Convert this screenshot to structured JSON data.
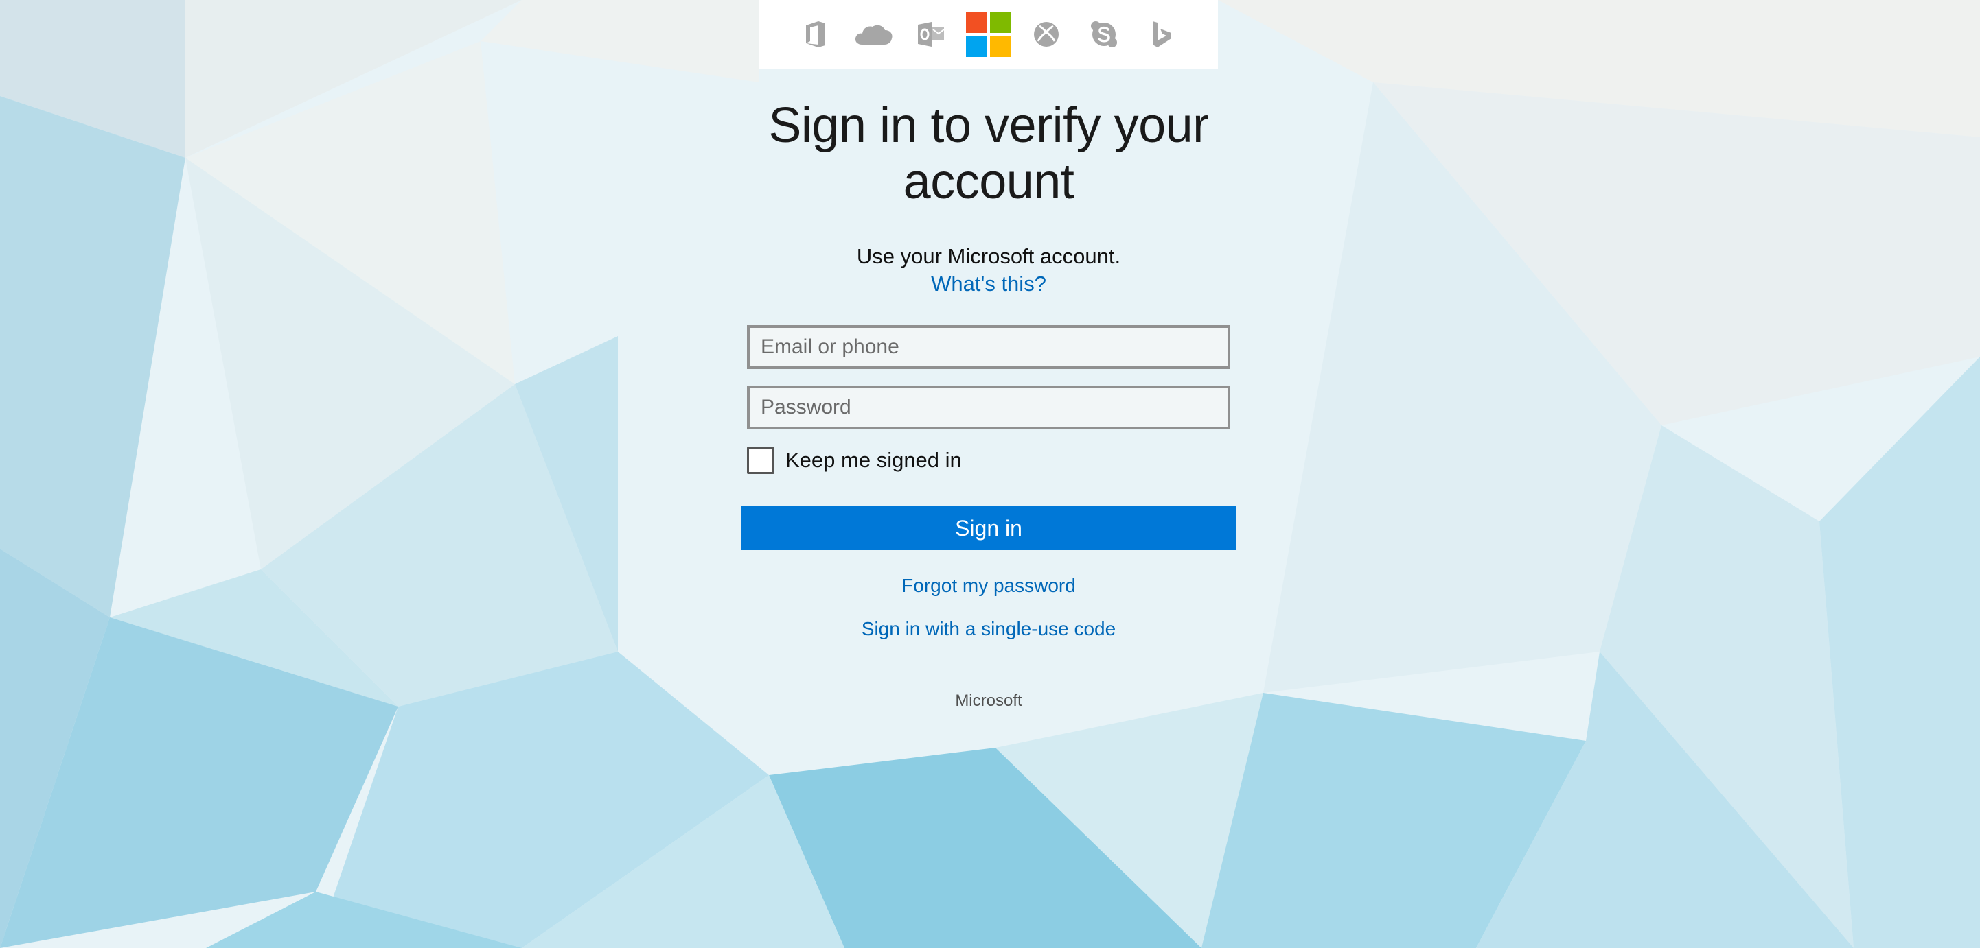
{
  "product_icons": [
    {
      "name": "office-icon"
    },
    {
      "name": "onedrive-icon"
    },
    {
      "name": "outlook-icon"
    },
    {
      "name": "microsoft-logo-icon",
      "colors": [
        "#f25022",
        "#7fba00",
        "#00a4ef",
        "#ffb900"
      ]
    },
    {
      "name": "xbox-icon"
    },
    {
      "name": "skype-icon"
    },
    {
      "name": "bing-icon"
    }
  ],
  "colors": {
    "accent": "#0078d7",
    "link": "#0067b8",
    "icon_gray": "#a6a6a6"
  },
  "heading": "Sign in to verify your account",
  "subtitle": "Use your Microsoft account.",
  "whats_this": "What's this?",
  "form": {
    "email_placeholder": "Email or phone",
    "email_value": "",
    "password_placeholder": "Password",
    "password_value": "",
    "keep_signed_in_label": "Keep me signed in",
    "keep_signed_in_checked": false,
    "signin_label": "Sign in"
  },
  "links": {
    "forgot_password": "Forgot my password",
    "single_use_code": "Sign in with a single-use code"
  },
  "footer": "Microsoft"
}
